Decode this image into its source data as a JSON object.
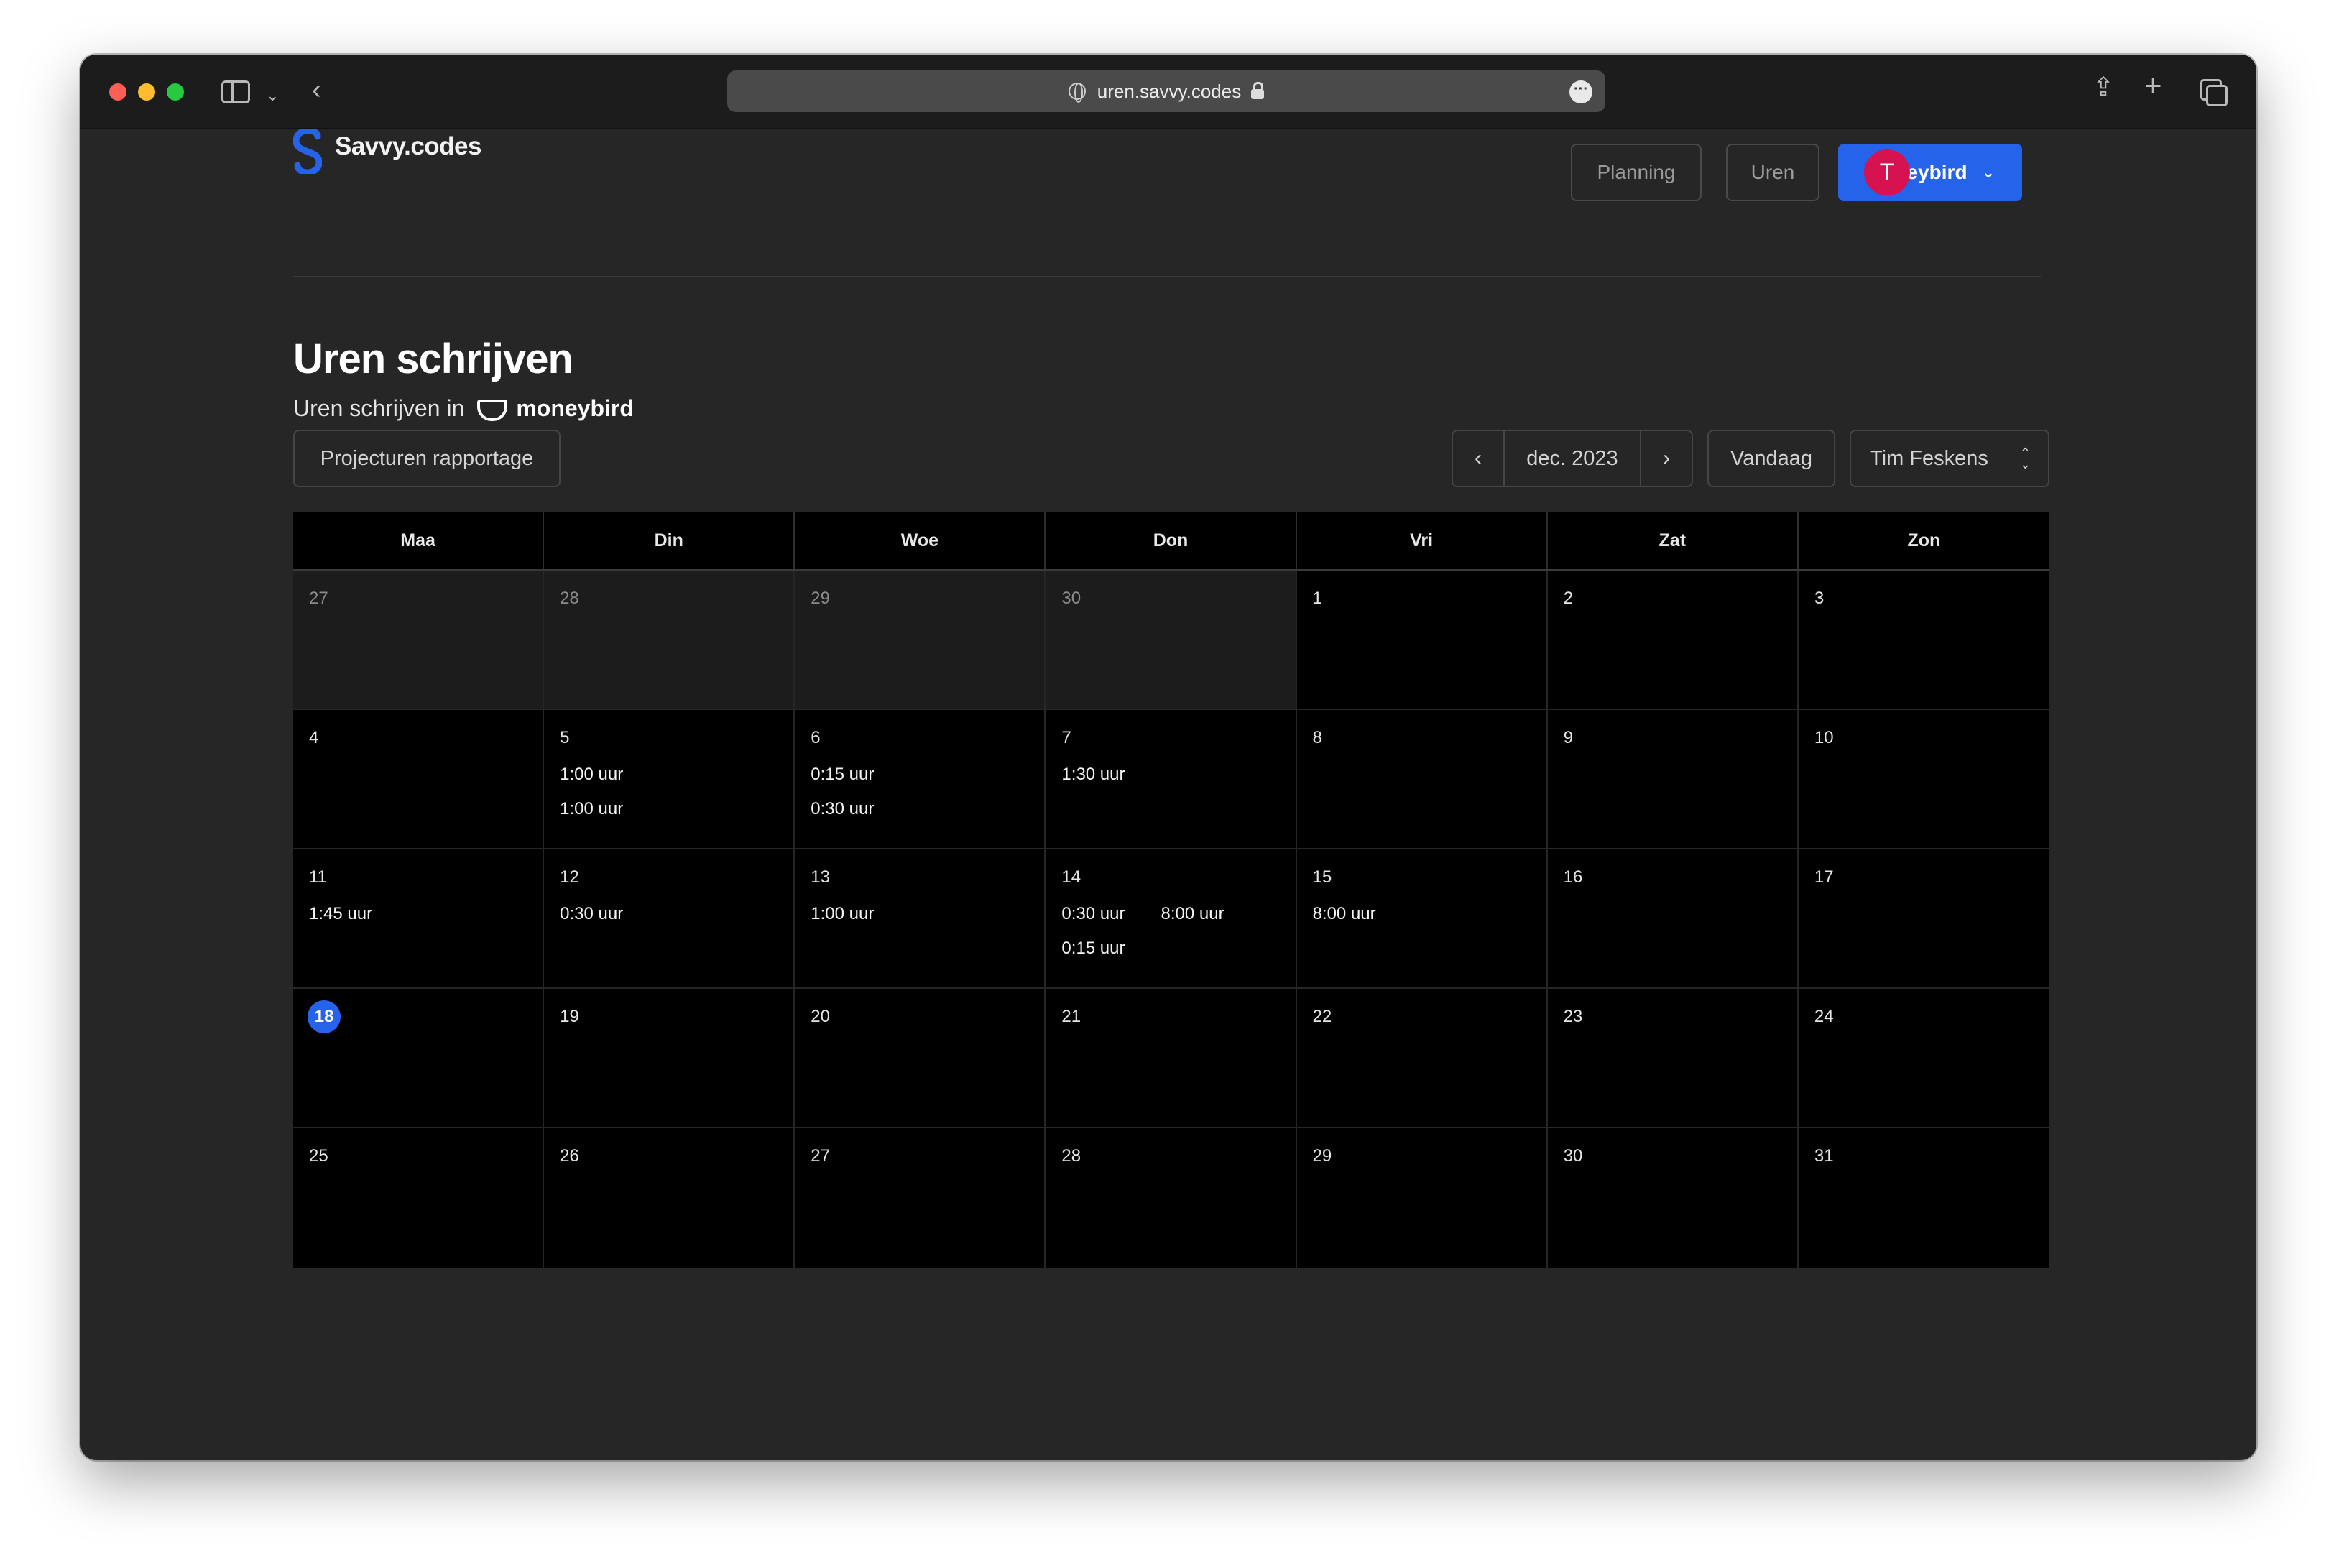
{
  "browser": {
    "url": "uren.savvy.codes"
  },
  "header": {
    "brand": "Savvy.codes",
    "nav": {
      "planning": "Planning",
      "uren": "Uren",
      "moneybird": "Moneybird"
    },
    "avatar_initial": "T"
  },
  "page": {
    "title": "Uren schrijven",
    "subtitle": "Uren schrijven in",
    "provider": "moneybird"
  },
  "toolbar": {
    "report_button": "Projecturen rapportage",
    "month": "dec. 2023",
    "today_button": "Vandaag",
    "user": "Tim Feskens"
  },
  "calendar": {
    "weekdays": [
      "Maa",
      "Din",
      "Woe",
      "Don",
      "Vri",
      "Zat",
      "Zon"
    ],
    "weeks": [
      [
        {
          "day": "27",
          "other": true,
          "entries": []
        },
        {
          "day": "28",
          "other": true,
          "entries": []
        },
        {
          "day": "29",
          "other": true,
          "entries": []
        },
        {
          "day": "30",
          "other": true,
          "entries": []
        },
        {
          "day": "1",
          "entries": []
        },
        {
          "day": "2",
          "entries": []
        },
        {
          "day": "3",
          "entries": []
        }
      ],
      [
        {
          "day": "4",
          "entries": []
        },
        {
          "day": "5",
          "entries": [
            [
              "1:00 uur",
              "1:00 uur"
            ]
          ]
        },
        {
          "day": "6",
          "entries": [
            [
              "0:15 uur",
              "0:30 uur"
            ]
          ]
        },
        {
          "day": "7",
          "entries": [
            [
              "1:30 uur"
            ]
          ]
        },
        {
          "day": "8",
          "entries": []
        },
        {
          "day": "9",
          "entries": []
        },
        {
          "day": "10",
          "entries": []
        }
      ],
      [
        {
          "day": "11",
          "entries": [
            [
              "1:45 uur"
            ]
          ]
        },
        {
          "day": "12",
          "entries": [
            [
              "0:30 uur"
            ]
          ]
        },
        {
          "day": "13",
          "entries": [
            [
              "1:00 uur"
            ]
          ]
        },
        {
          "day": "14",
          "entries": [
            [
              "0:30 uur",
              "0:15 uur"
            ],
            [
              "8:00 uur"
            ]
          ]
        },
        {
          "day": "15",
          "entries": [
            [
              "8:00 uur"
            ]
          ]
        },
        {
          "day": "16",
          "entries": []
        },
        {
          "day": "17",
          "entries": []
        }
      ],
      [
        {
          "day": "18",
          "today": true,
          "entries": []
        },
        {
          "day": "19",
          "entries": []
        },
        {
          "day": "20",
          "entries": []
        },
        {
          "day": "21",
          "entries": []
        },
        {
          "day": "22",
          "entries": []
        },
        {
          "day": "23",
          "entries": []
        },
        {
          "day": "24",
          "entries": []
        }
      ],
      [
        {
          "day": "25",
          "entries": []
        },
        {
          "day": "26",
          "entries": []
        },
        {
          "day": "27",
          "entries": []
        },
        {
          "day": "28",
          "entries": []
        },
        {
          "day": "29",
          "entries": []
        },
        {
          "day": "30",
          "entries": []
        },
        {
          "day": "31",
          "entries": []
        }
      ]
    ]
  },
  "colors": {
    "accent": "#2563eb",
    "avatar": "#d6124f",
    "background": "#262626",
    "calendar_bg": "#000000"
  }
}
